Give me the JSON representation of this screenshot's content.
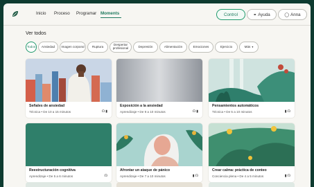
{
  "nav": {
    "links": [
      "Inicio",
      "Proceso",
      "Programar",
      "Moments"
    ],
    "active": "Moments",
    "control_label": "Control",
    "help_label": "Ayuda",
    "user_label": "Anna"
  },
  "section": {
    "title": "Ver todos"
  },
  "filters": [
    "Todos",
    "Ansiedad",
    "Imagen corporal",
    "Ruptura",
    "Despertar profesional",
    "Depresión",
    "Alimentación",
    "Emociones",
    "Ejercicio",
    "Más"
  ],
  "cards": [
    {
      "title": "Señales de ansiedad",
      "meta": "Técnica • De 10 a 15 minutos",
      "icons": [
        "headphones-icon",
        "video-icon"
      ]
    },
    {
      "title": "Exposición a la ansiedad",
      "meta": "Aprendizaje • De 9 a 10 minutos",
      "icons": [
        "headphones-icon",
        "video-icon"
      ]
    },
    {
      "title": "Pensamientos automáticos",
      "meta": "Técnica • De 5 a 10 minutos",
      "icons": [
        "video-icon",
        "headphones-icon"
      ]
    },
    {
      "title": "Reestructuración cognitiva",
      "meta": "Aprendizaje • De 5 a 6 minutos",
      "icons": [
        "headphones-icon"
      ]
    },
    {
      "title": "Afrontar un ataque de pánico",
      "meta": "Aprendizaje • De 7 a 10 minutos",
      "icons": [
        "video-icon",
        "headphones-icon"
      ]
    },
    {
      "title": "Crear calma: práctica de conteo",
      "meta": "Conciencia plena • De 4 a 5 minutos",
      "icons": [
        "video-icon",
        "headphones-icon"
      ]
    }
  ],
  "colors": {
    "accent": "#1f7a5e",
    "frame": "#0e3b30",
    "background": "#f7f6f2"
  }
}
